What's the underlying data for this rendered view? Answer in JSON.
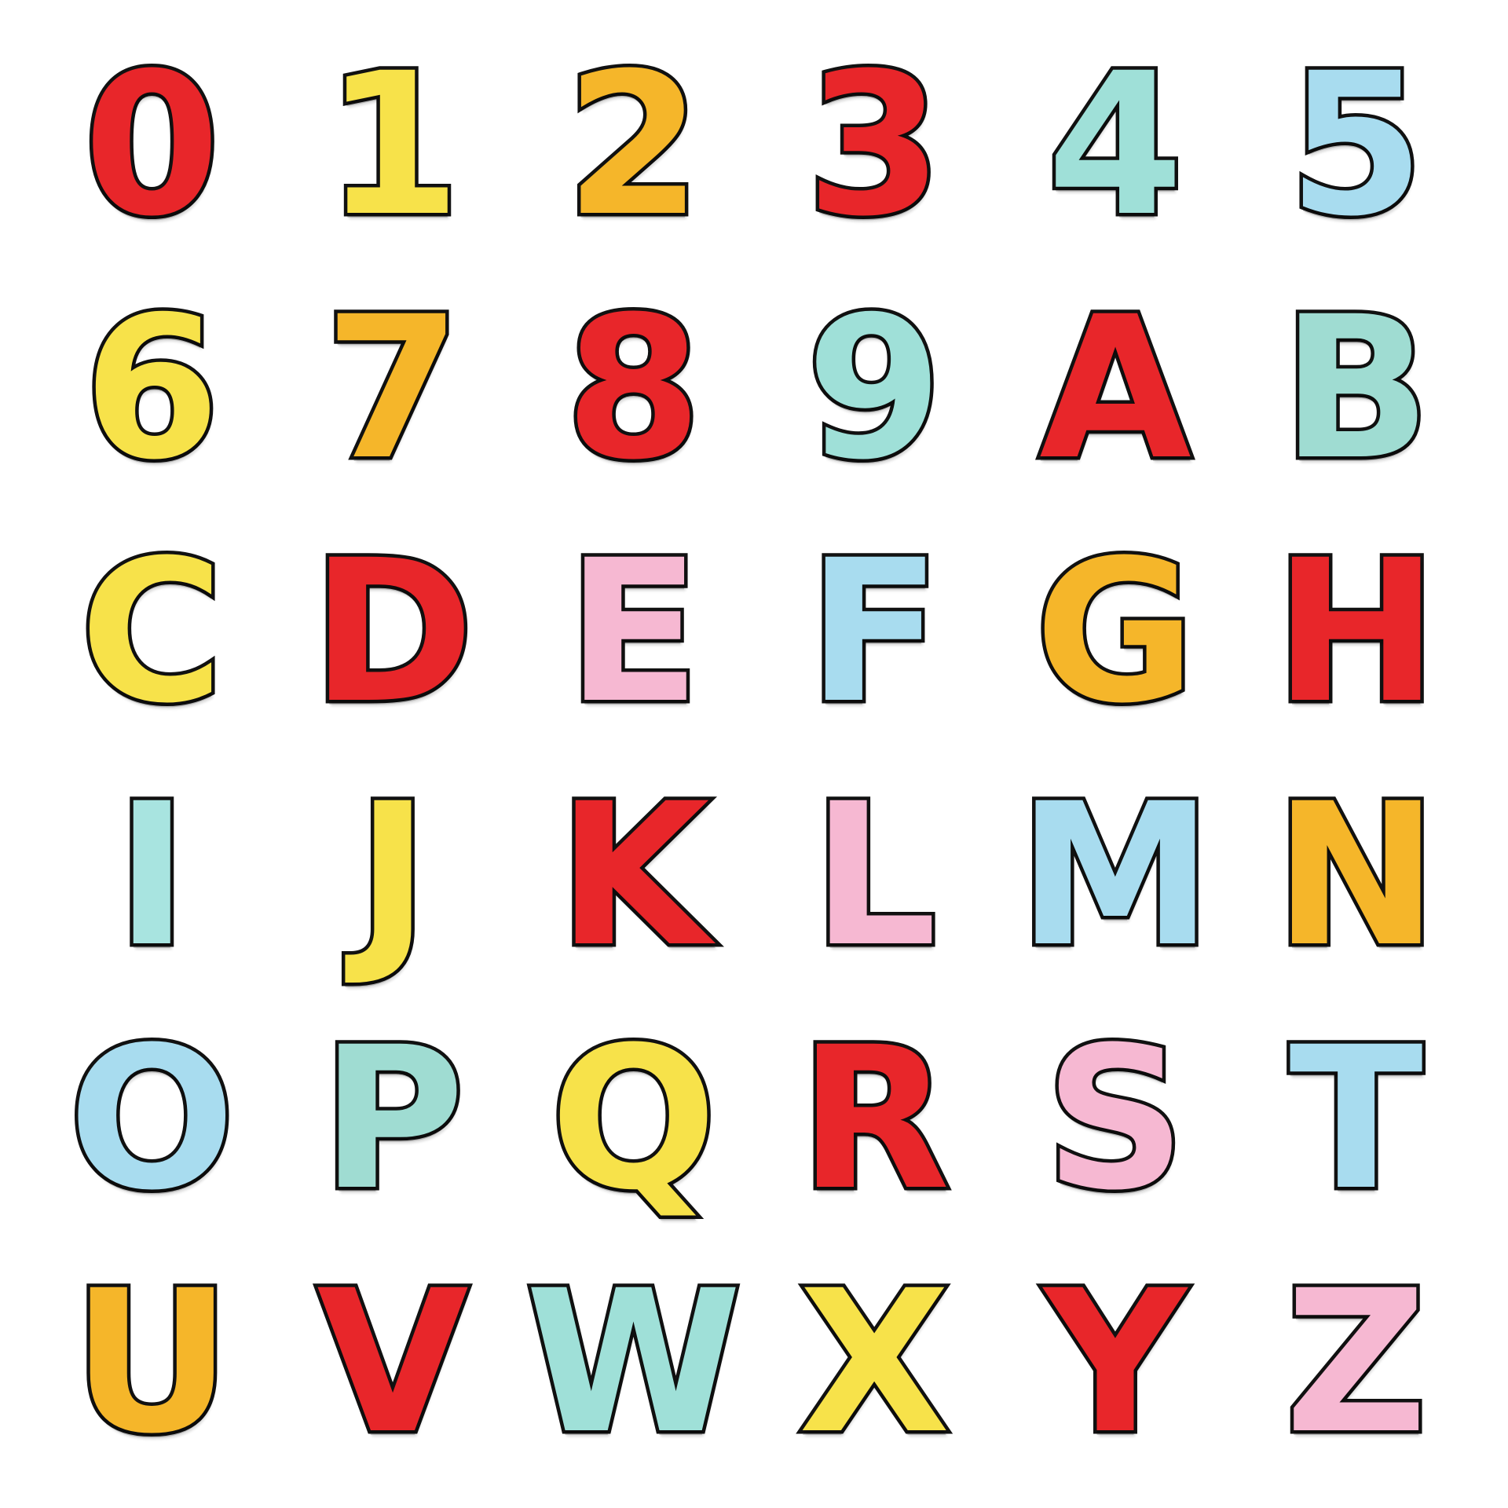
{
  "patches": [
    {
      "char": "0",
      "color": "#e8262a"
    },
    {
      "char": "1",
      "color": "#f7e24a"
    },
    {
      "char": "2",
      "color": "#f5b62a"
    },
    {
      "char": "3",
      "color": "#e8262a"
    },
    {
      "char": "4",
      "color": "#9fe0d8"
    },
    {
      "char": "5",
      "color": "#a8dcef"
    },
    {
      "char": "6",
      "color": "#f7e24a"
    },
    {
      "char": "7",
      "color": "#f5b62a"
    },
    {
      "char": "8",
      "color": "#e8262a"
    },
    {
      "char": "9",
      "color": "#9fe0d8"
    },
    {
      "char": "A",
      "color": "#e8262a"
    },
    {
      "char": "B",
      "color": "#9fdcd2"
    },
    {
      "char": "C",
      "color": "#f7e24a"
    },
    {
      "char": "D",
      "color": "#e8262a"
    },
    {
      "char": "E",
      "color": "#f6b8d2"
    },
    {
      "char": "F",
      "color": "#a8dcef"
    },
    {
      "char": "G",
      "color": "#f5b62a"
    },
    {
      "char": "H",
      "color": "#e8262a"
    },
    {
      "char": "I",
      "color": "#a8e4e0"
    },
    {
      "char": "J",
      "color": "#f7e24a"
    },
    {
      "char": "K",
      "color": "#e8262a"
    },
    {
      "char": "L",
      "color": "#f6b8d2"
    },
    {
      "char": "M",
      "color": "#a8dcef"
    },
    {
      "char": "N",
      "color": "#f5b62a"
    },
    {
      "char": "O",
      "color": "#a8dcef"
    },
    {
      "char": "P",
      "color": "#9fdcd2"
    },
    {
      "char": "Q",
      "color": "#f7e24a"
    },
    {
      "char": "R",
      "color": "#e8262a"
    },
    {
      "char": "S",
      "color": "#f6b8d2"
    },
    {
      "char": "T",
      "color": "#a8dcef"
    },
    {
      "char": "U",
      "color": "#f5b62a"
    },
    {
      "char": "V",
      "color": "#e8262a"
    },
    {
      "char": "W",
      "color": "#9fe0d8"
    },
    {
      "char": "X",
      "color": "#f7e24a"
    },
    {
      "char": "Y",
      "color": "#e8262a"
    },
    {
      "char": "Z",
      "color": "#f6b8d2"
    }
  ]
}
